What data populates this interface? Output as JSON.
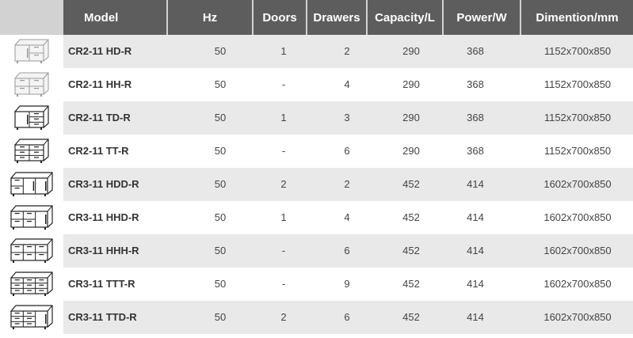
{
  "headers": {
    "model": "Model",
    "hz": "Hz",
    "doors": "Doors",
    "drawers": "Drawers",
    "capacity": "Capacity/L",
    "power": "Power/W",
    "dimension": "Dimention/mm"
  },
  "colors": {
    "header_bg": "#5d5d5d",
    "header_gap": "#d2d2d2",
    "row_alt": "#e9e9e9",
    "row": "#ffffff"
  },
  "rows": [
    {
      "image": "two-section-counter-1-door-2-drawers",
      "model": "CR2-11 HD-R",
      "hz": "50",
      "doors": "1",
      "drawers": "2",
      "capacity": "290",
      "power": "368",
      "dimension": "1152x700x850"
    },
    {
      "image": "two-section-counter-4-drawers",
      "model": "CR2-11 HH-R",
      "hz": "50",
      "doors": "-",
      "drawers": "4",
      "capacity": "290",
      "power": "368",
      "dimension": "1152x700x850"
    },
    {
      "image": "two-section-counter-1-door-3-drawers",
      "model": "CR2-11 TD-R",
      "hz": "50",
      "doors": "1",
      "drawers": "3",
      "capacity": "290",
      "power": "368",
      "dimension": "1152x700x850"
    },
    {
      "image": "two-section-counter-6-drawers",
      "model": "CR2-11 TT-R",
      "hz": "50",
      "doors": "-",
      "drawers": "6",
      "capacity": "290",
      "power": "368",
      "dimension": "1152x700x850"
    },
    {
      "image": "three-section-counter-2-doors-2-drawers",
      "model": "CR3-11 HDD-R",
      "hz": "50",
      "doors": "2",
      "drawers": "2",
      "capacity": "452",
      "power": "414",
      "dimension": "1602x700x850"
    },
    {
      "image": "three-section-counter-1-door-4-drawers",
      "model": "CR3-11 HHD-R",
      "hz": "50",
      "doors": "1",
      "drawers": "4",
      "capacity": "452",
      "power": "414",
      "dimension": "1602x700x850"
    },
    {
      "image": "three-section-counter-6-drawers",
      "model": "CR3-11 HHH-R",
      "hz": "50",
      "doors": "-",
      "drawers": "6",
      "capacity": "452",
      "power": "414",
      "dimension": "1602x700x850"
    },
    {
      "image": "three-section-counter-9-drawers",
      "model": "CR3-11 TTT-R",
      "hz": "50",
      "doors": "-",
      "drawers": "9",
      "capacity": "452",
      "power": "414",
      "dimension": "1602x700x850"
    },
    {
      "image": "three-section-counter-2-doors-6-drawers",
      "model": "CR3-11 TTD-R",
      "hz": "50",
      "doors": "2",
      "drawers": "6",
      "capacity": "452",
      "power": "414",
      "dimension": "1602x700x850"
    }
  ]
}
